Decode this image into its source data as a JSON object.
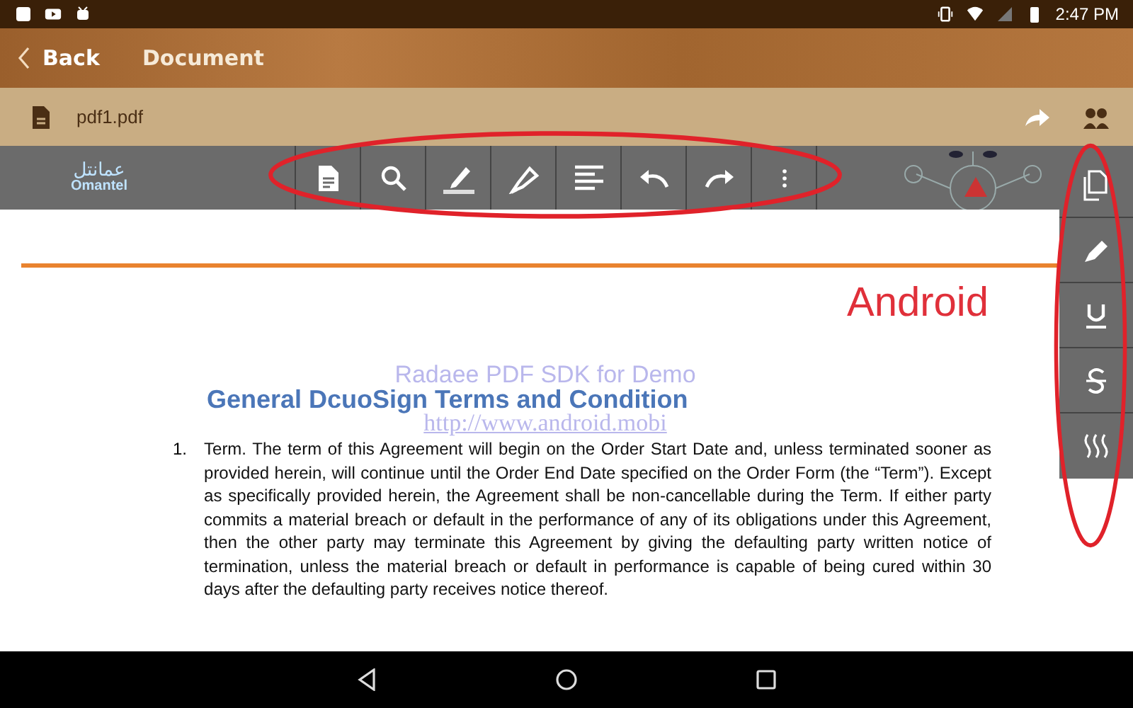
{
  "status_bar": {
    "time": "2:47 PM"
  },
  "app_bar": {
    "back": "Back",
    "title": "Document"
  },
  "file_bar": {
    "file_name": "pdf1.pdf"
  },
  "document": {
    "left_logo": {
      "arabic": "عمانتل",
      "latin": "Omantel"
    },
    "annotation": "Android",
    "watermark": [
      "Radaee PDF SDK for Demo",
      "http://www.android.mobi"
    ],
    "heading": "General DcuoSign Terms and Condition",
    "items": [
      {
        "number": "1.",
        "text": "Term.  The term of this Agreement will begin on the Order Start Date and, unless terminated sooner as provided herein, will continue until the Order End Date specified on the Order Form (the “Term”). Except as specifically provided herein, the Agreement shall be non-cancellable during the Term.  If either party commits a material breach or default in the performance of any of its obligations under this Agreement, then the other party may terminate this Agreement by giving the defaulting party written notice of termination, unless the material breach or default in performance is capable of being cured within 30 days after the defaulting party receives notice thereof."
      }
    ]
  }
}
